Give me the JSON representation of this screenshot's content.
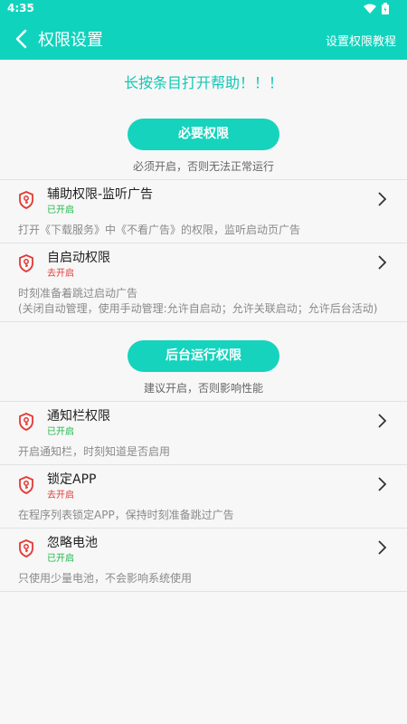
{
  "status_bar": {
    "time": "4:35"
  },
  "app_bar": {
    "title": "权限设置",
    "action": "设置权限教程"
  },
  "hint": "长按条目打开帮助！！！",
  "sections": [
    {
      "button": "必要权限",
      "note": "必须开启，否则无法正常运行",
      "items": [
        {
          "name": "辅助权限-监听广告",
          "status": "已开启",
          "enabled": true,
          "desc": [
            "打开《下载服务》中《不看广告》的权限，监听启动页广告"
          ]
        },
        {
          "name": "自启动权限",
          "status": "去开启",
          "enabled": false,
          "desc": [
            "时刻准备着跳过启动广告",
            "(关闭自动管理，使用手动管理:允许自启动；允许关联启动；允许后台活动)"
          ]
        }
      ]
    },
    {
      "button": "后台运行权限",
      "note": "建议开启，否则影响性能",
      "items": [
        {
          "name": "通知栏权限",
          "status": "已开启",
          "enabled": true,
          "desc": [
            "开启通知栏，时刻知道是否启用"
          ]
        },
        {
          "name": "锁定APP",
          "status": "去开启",
          "enabled": false,
          "desc": [
            "在程序列表锁定APP，保持时刻准备跳过广告"
          ]
        },
        {
          "name": "忽略电池",
          "status": "已开启",
          "enabled": true,
          "desc": [
            "只使用少量电池，不会影响系统使用"
          ]
        }
      ]
    }
  ],
  "colors": {
    "accent": "#10d3be",
    "enabled": "#1fb84a",
    "disabled": "#e53935",
    "shield": "#e53935"
  },
  "icons": {
    "back": "chevron-left-icon",
    "item": "shield-key-icon",
    "chevron": "chevron-right-icon"
  }
}
